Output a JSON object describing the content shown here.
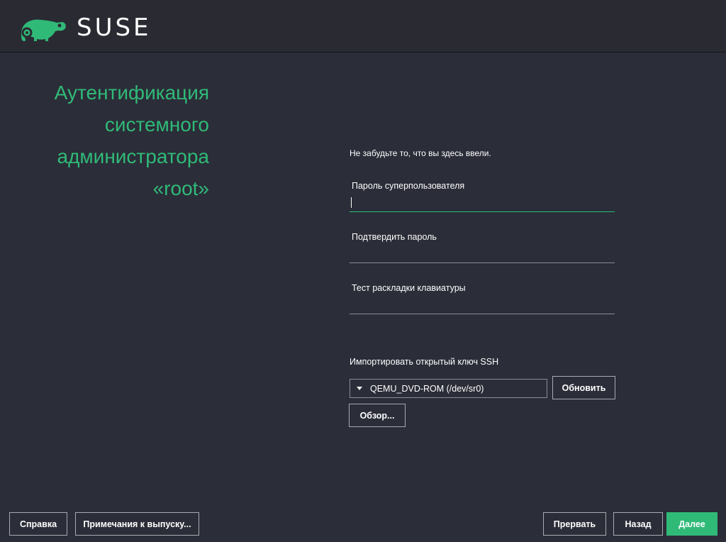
{
  "header": {
    "logo_text": "SUSE",
    "logo_icon": "chameleon-icon",
    "brand_color": "#30ba78"
  },
  "title_lines": [
    "Аутентификация",
    "системного",
    "администратора",
    "«root»"
  ],
  "hint": "Не забудьте то, что вы здесь ввели.",
  "fields": {
    "password": {
      "label": "Пароль суперпользователя",
      "value": "",
      "focused": true
    },
    "confirm": {
      "label": "Подтвердить пароль",
      "value": ""
    },
    "keyboard_test": {
      "label": "Тест раскладки клавиатуры",
      "value": ""
    }
  },
  "ssh": {
    "label": "Импортировать открытый ключ SSH",
    "selected_device": "QEMU_DVD-ROM (/dev/sr0)",
    "refresh_label": "Обновить",
    "browse_label": "Обзор..."
  },
  "footer": {
    "help_label": "Справка",
    "release_notes_label": "Примечания к выпуску...",
    "abort_label": "Прервать",
    "back_label": "Назад",
    "next_label": "Далее"
  }
}
